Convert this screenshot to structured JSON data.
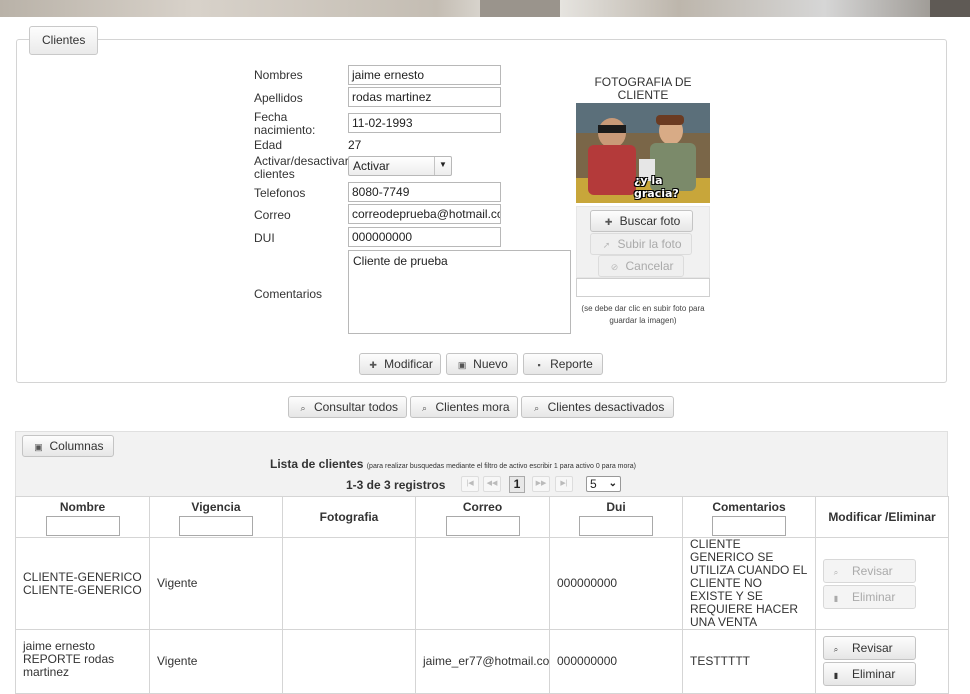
{
  "legend": "Clientes",
  "form": {
    "nombres_label": "Nombres",
    "nombres_value": "jaime ernesto",
    "apellidos_label": "Apellidos",
    "apellidos_value": "rodas martinez",
    "fecha_label_1": "Fecha",
    "fecha_label_2": "nacimiento:",
    "fecha_value": "11-02-1993",
    "edad_label": "Edad",
    "edad_value": "27",
    "activar_label_1": "Activar/desactivar",
    "activar_label_2": "clientes",
    "activar_value": "Activar",
    "telefonos_label": "Telefonos",
    "telefonos_value": "8080-7749",
    "correo_label": "Correo",
    "correo_value": "correodeprueba@hotmail.com",
    "dui_label": "DUI",
    "dui_value": "000000000",
    "comentarios_label": "Comentarios",
    "comentarios_value": "Cliente de prueba"
  },
  "photo": {
    "title": "FOTOGRAFIA DE CLIENTE",
    "caption": "¿y la gracia?",
    "buscar": "Buscar foto",
    "subir": "Subir la foto",
    "cancelar": "Cancelar",
    "note": "(se debe dar clic en subir foto para guardar la imagen)"
  },
  "actions": {
    "modificar": "Modificar",
    "nuevo": "Nuevo",
    "reporte": "Reporte"
  },
  "filters": {
    "todos": "Consultar todos",
    "mora": "Clientes mora",
    "desactivados": "Clientes desactivados"
  },
  "grid": {
    "columnas_button": "Columnas",
    "caption": "Lista de clientes",
    "caption_note": "(para realizar busquedas mediante el filtro de activo escribir 1 para activo 0 para mora)",
    "pager_info": "1-3 de 3 registros",
    "current_page": "1",
    "page_size": "5",
    "headers": {
      "nombre": "Nombre",
      "vigencia": "Vigencia",
      "fotografia": "Fotografia",
      "correo": "Correo",
      "dui": "Dui",
      "comentarios": "Comentarios",
      "acciones": "Modificar /Eliminar"
    },
    "rows": [
      {
        "nombre": "CLIENTE-GENERICO CLIENTE-GENERICO",
        "vigencia": "Vigente",
        "fotografia": "",
        "correo": "",
        "dui": "000000000",
        "comentarios": "CLIENTE GENERICO SE UTILIZA CUANDO EL CLIENTE NO EXISTE Y SE REQUIERE HACER UNA VENTA",
        "revisar": "Revisar",
        "eliminar": "Eliminar"
      },
      {
        "nombre": "jaime ernesto REPORTE rodas martinez",
        "vigencia": "Vigente",
        "fotografia": "",
        "correo": "jaime_er77@hotmail.com",
        "dui": "000000000",
        "comentarios": "TESTTTTT",
        "revisar": "Revisar",
        "eliminar": "Eliminar"
      }
    ]
  }
}
